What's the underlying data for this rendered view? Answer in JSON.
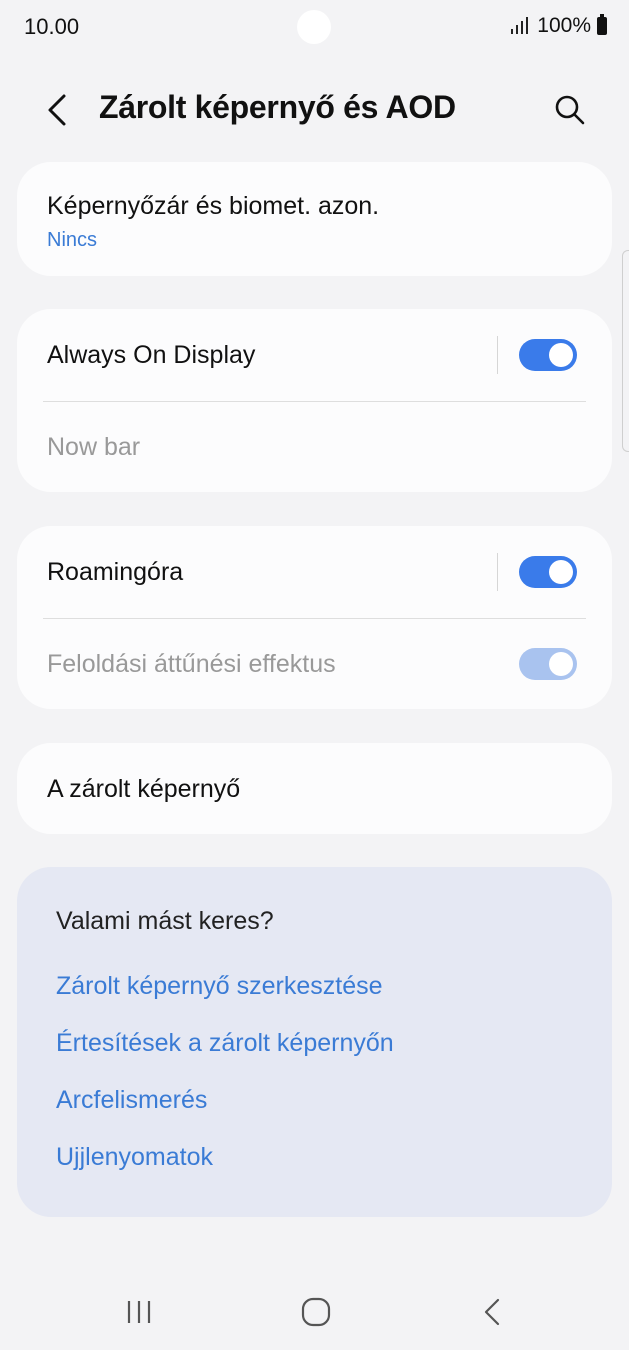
{
  "status_bar": {
    "time": "10.00",
    "battery": "100%"
  },
  "header": {
    "title": "Zárolt képernyő és AOD",
    "back_icon": "chevron-left-icon",
    "search_icon": "search-icon"
  },
  "sections": {
    "lock": {
      "title": "Képernyőzár és biomet. azon.",
      "subtitle": "Nincs"
    },
    "aod": {
      "title": "Always On Display",
      "toggle_on": true,
      "now_bar": "Now bar"
    },
    "roaming": {
      "title": "Roamingóra",
      "toggle_on": true,
      "unlock_effect": "Feloldási áttűnési effektus",
      "unlock_effect_on": true
    },
    "lockscreen": {
      "title": "A zárolt képernyő"
    }
  },
  "suggestions": {
    "heading": "Valami mást keres?",
    "links": [
      "Zárolt képernyő szerkesztése",
      "Értesítések a zárolt képernyőn",
      "Arcfelismerés",
      "Ujjlenyomatok"
    ]
  },
  "navbar": {
    "recent_icon": "recent-apps-icon",
    "home_icon": "home-icon",
    "back_icon": "back-icon"
  },
  "colors": {
    "accent": "#3a7bea",
    "link": "#3a7bd5",
    "background": "#f3f3f5",
    "card": "#fcfcfd",
    "suggest_bg": "#e5e8f3"
  }
}
